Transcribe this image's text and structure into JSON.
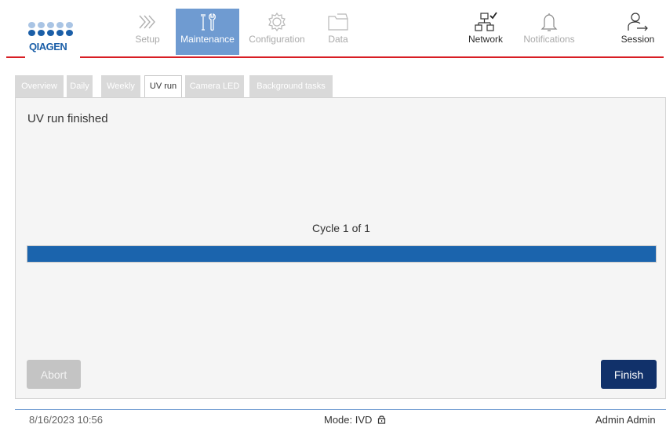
{
  "brand": {
    "logo_text": "QIAGEN"
  },
  "nav": {
    "setup": "Setup",
    "maintenance": "Maintenance",
    "configuration": "Configuration",
    "data": "Data",
    "network": "Network",
    "notifications": "Notifications",
    "session": "Session"
  },
  "tabs": [
    "Overview",
    "Daily",
    "Weekly",
    "UV run",
    "Camera LED",
    "Background tasks"
  ],
  "active_tab": "UV run",
  "main": {
    "status_title": "UV run finished",
    "cycle_label": "Cycle 1 of 1",
    "progress_percent": 100,
    "abort_label": "Abort",
    "finish_label": "Finish"
  },
  "footer": {
    "datetime": "8/16/2023 10:56",
    "mode": "Mode: IVD",
    "user": "Admin Admin"
  },
  "icons": {
    "setup": "chevrons-right-icon",
    "maintenance": "tools-icon",
    "configuration": "gear-icon",
    "data": "folder-icon",
    "network": "network-icon",
    "notifications": "bell-icon",
    "session": "user-exit-icon",
    "mode_lock": "lock-icon"
  },
  "colors": {
    "brand_blue": "#1b5fa8",
    "brand_red": "#d81e24",
    "active_nav": "#6f9bd1",
    "progress": "#1b64ad",
    "finish_button": "#11316a",
    "abort_button": "#c4c4c4"
  }
}
